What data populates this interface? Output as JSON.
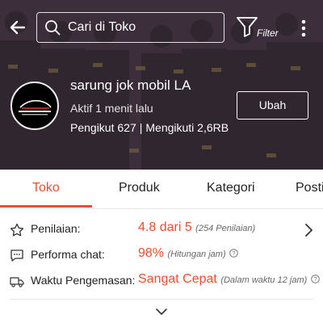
{
  "search": {
    "placeholder": "Cari di Toko"
  },
  "filter": {
    "label": "Filter"
  },
  "shop": {
    "name": "sarung jok mobil LA",
    "active_status": "Aktif 1 menit lalu",
    "followers": "Pengikut 627",
    "separator": "|",
    "following": "Mengikuti 2,6RB",
    "edit_label": "Ubah"
  },
  "tabs": [
    "Toko",
    "Produk",
    "Kategori",
    "Posti"
  ],
  "stats": {
    "rating": {
      "label": "Penilaian:",
      "value": "4.8 dari 5",
      "sub": "(254 Penilaian)"
    },
    "chat": {
      "label": "Performa chat:",
      "value": "98%",
      "sub": "(Hitungan jam)"
    },
    "packing": {
      "label": "Waktu Pengemasan:",
      "value": "Sangat Cepat",
      "sub": "(Dalam waktu 12 jam)"
    }
  },
  "colors": {
    "accent": "#ee4d2d",
    "header_bg": "#3d3040"
  }
}
